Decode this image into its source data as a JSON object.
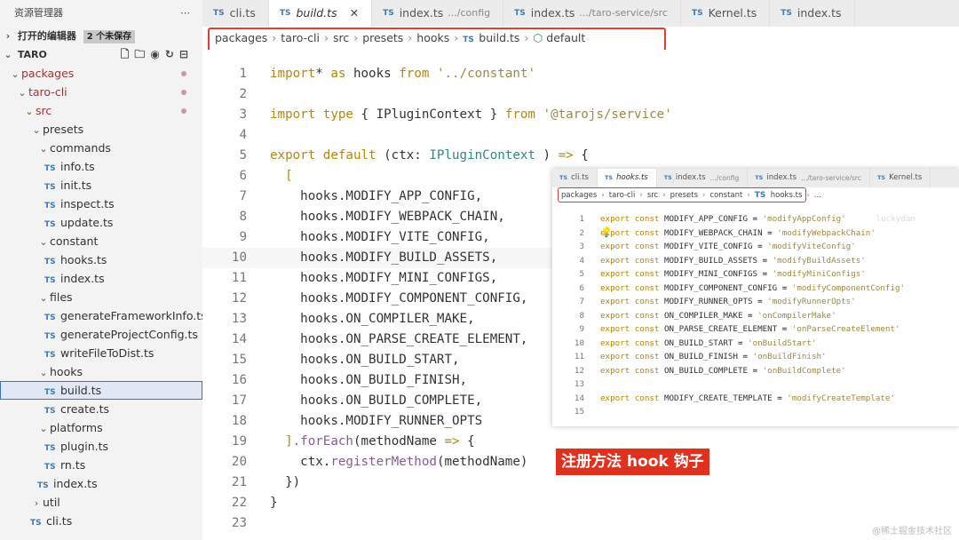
{
  "explorer": {
    "title": "资源管理器",
    "more_icon": "ellipsis-icon",
    "open_editors": {
      "label": "打开的编辑器",
      "badge": "2 个未保存"
    },
    "project": "TARO",
    "tree": [
      {
        "label": "packages",
        "depth": 1,
        "kind": "folder",
        "open": true,
        "modified": true
      },
      {
        "label": "taro-cli",
        "depth": 2,
        "kind": "folder",
        "open": true,
        "modified": true
      },
      {
        "label": "src",
        "depth": 3,
        "kind": "folder",
        "open": true,
        "modified": true
      },
      {
        "label": "presets",
        "depth": 4,
        "kind": "folder",
        "open": true
      },
      {
        "label": "commands",
        "depth": 5,
        "kind": "folder",
        "open": true
      },
      {
        "label": "info.ts",
        "depth": 6,
        "kind": "file"
      },
      {
        "label": "init.ts",
        "depth": 6,
        "kind": "file"
      },
      {
        "label": "inspect.ts",
        "depth": 6,
        "kind": "file"
      },
      {
        "label": "update.ts",
        "depth": 6,
        "kind": "file"
      },
      {
        "label": "constant",
        "depth": 5,
        "kind": "folder",
        "open": true
      },
      {
        "label": "hooks.ts",
        "depth": 6,
        "kind": "file"
      },
      {
        "label": "index.ts",
        "depth": 6,
        "kind": "file"
      },
      {
        "label": "files",
        "depth": 5,
        "kind": "folder",
        "open": true
      },
      {
        "label": "generateFrameworkInfo.ts",
        "depth": 6,
        "kind": "file"
      },
      {
        "label": "generateProjectConfig.ts",
        "depth": 6,
        "kind": "file"
      },
      {
        "label": "writeFileToDist.ts",
        "depth": 6,
        "kind": "file"
      },
      {
        "label": "hooks",
        "depth": 5,
        "kind": "folder",
        "open": true
      },
      {
        "label": "build.ts",
        "depth": 6,
        "kind": "file",
        "selected": true
      },
      {
        "label": "create.ts",
        "depth": 6,
        "kind": "file"
      },
      {
        "label": "platforms",
        "depth": 5,
        "kind": "folder",
        "open": true
      },
      {
        "label": "plugin.ts",
        "depth": 6,
        "kind": "file"
      },
      {
        "label": "rn.ts",
        "depth": 6,
        "kind": "file"
      },
      {
        "label": "index.ts",
        "depth": 5,
        "kind": "file"
      },
      {
        "label": "util",
        "depth": 4,
        "kind": "folder",
        "open": false
      },
      {
        "label": "cli.ts",
        "depth": 4,
        "kind": "file"
      }
    ]
  },
  "tabs": [
    {
      "label": "cli.ts",
      "desc": "",
      "active": false
    },
    {
      "label": "build.ts",
      "desc": "",
      "active": true
    },
    {
      "label": "index.ts",
      "desc": ".../config",
      "active": false
    },
    {
      "label": "index.ts",
      "desc": ".../taro-service/src",
      "active": false
    },
    {
      "label": "Kernel.ts",
      "desc": "",
      "active": false
    },
    {
      "label": "index.ts",
      "desc": "",
      "active": false
    }
  ],
  "ts_badge": "TS",
  "breadcrumb": [
    "packages",
    "taro-cli",
    "src",
    "presets",
    "hooks",
    "build.ts",
    "default"
  ],
  "code": [
    {
      "n": "1",
      "t": [
        [
          "kw",
          "import"
        ],
        [
          "",
          "* "
        ],
        [
          "kw",
          "as"
        ],
        [
          "",
          " hooks "
        ],
        [
          "kw",
          "from"
        ],
        [
          "",
          " "
        ],
        [
          "str",
          "'../constant'"
        ]
      ]
    },
    {
      "n": "2",
      "t": []
    },
    {
      "n": "3",
      "t": [
        [
          "kw",
          "import"
        ],
        [
          "",
          " "
        ],
        [
          "kw",
          "type"
        ],
        [
          "",
          " { IPluginContext } "
        ],
        [
          "kw",
          "from"
        ],
        [
          "",
          " "
        ],
        [
          "str",
          "'@tarojs/service'"
        ]
      ]
    },
    {
      "n": "4",
      "t": []
    },
    {
      "n": "5",
      "t": [
        [
          "kw",
          "export"
        ],
        [
          "",
          " "
        ],
        [
          "kw",
          "default"
        ],
        [
          "",
          " (ctx: "
        ],
        [
          "type",
          "IPluginContext"
        ],
        [
          "",
          " ) "
        ],
        [
          "kw",
          "=>"
        ],
        [
          "",
          " {"
        ]
      ]
    },
    {
      "n": "6",
      "t": [
        [
          "",
          "  "
        ],
        [
          "kw",
          "["
        ]
      ]
    },
    {
      "n": "7",
      "t": [
        [
          "",
          "    hooks.MODIFY_APP_CONFIG,"
        ]
      ]
    },
    {
      "n": "8",
      "t": [
        [
          "",
          "    hooks.MODIFY_WEBPACK_CHAIN,"
        ]
      ]
    },
    {
      "n": "9",
      "t": [
        [
          "",
          "    hooks.MODIFY_VITE_CONFIG,"
        ]
      ]
    },
    {
      "n": "10",
      "t": [
        [
          "",
          "    hooks.MODIFY_BUILD_ASSETS,"
        ]
      ]
    },
    {
      "n": "11",
      "t": [
        [
          "",
          "    hooks.MODIFY_MINI_CONFIGS,"
        ]
      ]
    },
    {
      "n": "12",
      "t": [
        [
          "",
          "    hooks.MODIFY_COMPONENT_CONFIG,"
        ]
      ]
    },
    {
      "n": "13",
      "t": [
        [
          "",
          "    hooks.ON_COMPILER_MAKE,"
        ]
      ]
    },
    {
      "n": "14",
      "t": [
        [
          "",
          "    hooks.ON_PARSE_CREATE_ELEMENT,"
        ]
      ]
    },
    {
      "n": "15",
      "t": [
        [
          "",
          "    hooks.ON_BUILD_START,"
        ]
      ]
    },
    {
      "n": "16",
      "t": [
        [
          "",
          "    hooks.ON_BUILD_FINISH,"
        ]
      ]
    },
    {
      "n": "17",
      "t": [
        [
          "",
          "    hooks.ON_BUILD_COMPLETE,"
        ]
      ]
    },
    {
      "n": "18",
      "t": [
        [
          "",
          "    hooks.MODIFY_RUNNER_OPTS"
        ]
      ]
    },
    {
      "n": "19",
      "t": [
        [
          "",
          "  "
        ],
        [
          "kw",
          "]"
        ],
        [
          "fn",
          ".forEach"
        ],
        [
          "",
          "(methodName "
        ],
        [
          "kw",
          "=>"
        ],
        [
          "",
          " {"
        ]
      ]
    },
    {
      "n": "20",
      "t": [
        [
          "",
          "    ctx."
        ],
        [
          "fn",
          "registerMethod"
        ],
        [
          "",
          "(methodName)"
        ]
      ]
    },
    {
      "n": "21",
      "t": [
        [
          "",
          "  })"
        ]
      ]
    },
    {
      "n": "22",
      "t": [
        [
          "",
          "}"
        ]
      ]
    },
    {
      "n": "23",
      "t": []
    }
  ],
  "inset": {
    "tabs": [
      {
        "label": "cli.ts",
        "desc": ""
      },
      {
        "label": "hooks.ts",
        "desc": "",
        "active": true
      },
      {
        "label": "index.ts",
        "desc": ".../config"
      },
      {
        "label": "index.ts",
        "desc": ".../taro-service/src"
      },
      {
        "label": "Kernel.ts",
        "desc": ""
      }
    ],
    "breadcrumb": [
      "packages",
      "taro-cli",
      "src",
      "presets",
      "constant",
      "hooks.ts",
      "..."
    ],
    "ghost_text": "luckydan",
    "lines": [
      {
        "n": "1",
        "name": "MODIFY_APP_CONFIG",
        "val": "'modifyAppConfig'"
      },
      {
        "n": "2",
        "name": "MODIFY_WEBPACK_CHAIN",
        "val": "'modifyWebpackChain'"
      },
      {
        "n": "3",
        "name": "MODIFY_VITE_CONFIG",
        "val": "'modifyViteConfig'"
      },
      {
        "n": "4",
        "name": "MODIFY_BUILD_ASSETS",
        "val": "'modifyBuildAssets'"
      },
      {
        "n": "5",
        "name": "MODIFY_MINI_CONFIGS",
        "val": "'modifyMiniConfigs'"
      },
      {
        "n": "6",
        "name": "MODIFY_COMPONENT_CONFIG",
        "val": "'modifyComponentConfig'"
      },
      {
        "n": "7",
        "name": "MODIFY_RUNNER_OPTS",
        "val": "'modifyRunnerOpts'"
      },
      {
        "n": "8",
        "name": "ON_COMPILER_MAKE",
        "val": "'onCompilerMake'"
      },
      {
        "n": "9",
        "name": "ON_PARSE_CREATE_ELEMENT",
        "val": "'onParseCreateElement'"
      },
      {
        "n": "10",
        "name": "ON_BUILD_START",
        "val": "'onBuildStart'"
      },
      {
        "n": "11",
        "name": "ON_BUILD_FINISH",
        "val": "'onBuildFinish'"
      },
      {
        "n": "12",
        "name": "ON_BUILD_COMPLETE",
        "val": "'onBuildComplete'"
      },
      {
        "n": "13",
        "name": "",
        "val": ""
      },
      {
        "n": "14",
        "name": "MODIFY_CREATE_TEMPLATE",
        "val": "'modifyCreateTemplate'"
      },
      {
        "n": "15",
        "name": "",
        "val": ""
      }
    ],
    "export_kw": "export",
    "const_kw": "const"
  },
  "callout": "注册方法 hook 钩子",
  "watermark": "@稀土掘金技术社区",
  "colors": {
    "accent_red": "#e0311f",
    "keyword": "#b8860b",
    "string": "#a08844"
  }
}
